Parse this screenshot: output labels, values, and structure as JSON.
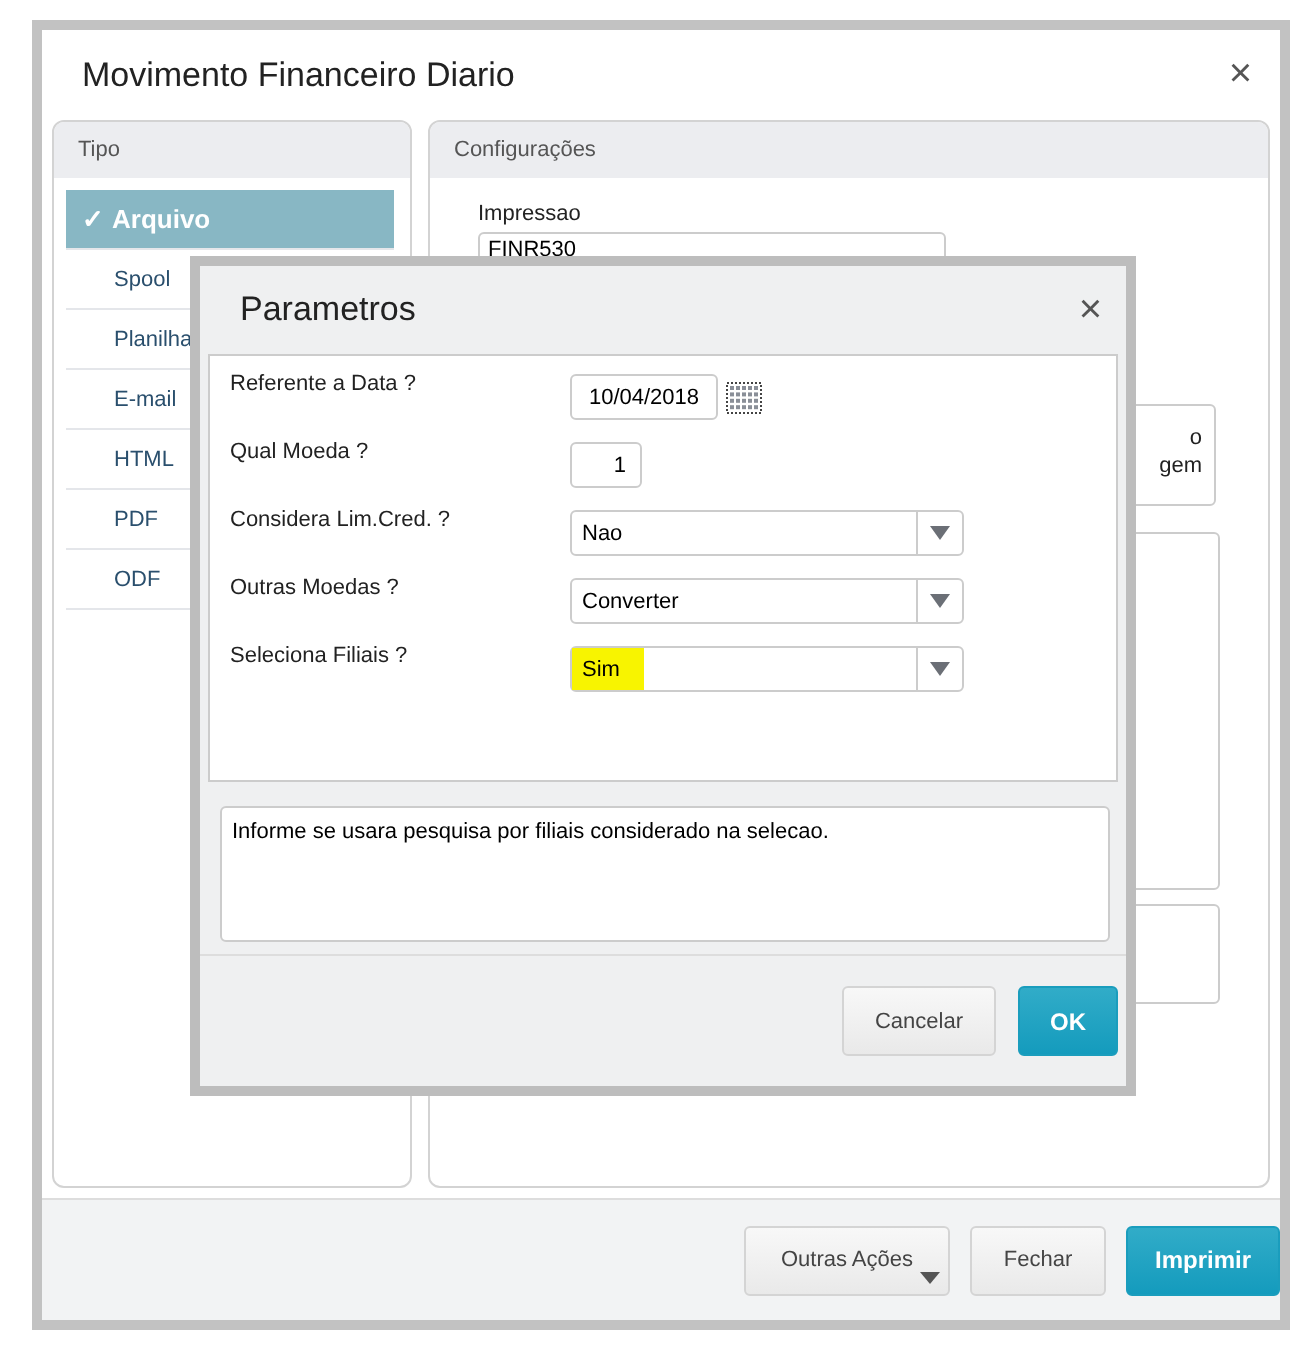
{
  "window": {
    "title": "Movimento Financeiro Diario",
    "close": "×"
  },
  "sidebar": {
    "title": "Tipo",
    "items": [
      {
        "label": "Arquivo",
        "selected": true,
        "check": "✓"
      },
      {
        "label": "Spool",
        "selected": false
      },
      {
        "label": "Planilha",
        "selected": false
      },
      {
        "label": "E-mail",
        "selected": false
      },
      {
        "label": "HTML",
        "selected": false
      },
      {
        "label": "PDF",
        "selected": false
      },
      {
        "label": "ODF",
        "selected": false
      }
    ]
  },
  "config": {
    "title": "Configurações",
    "field_label": "Impressao",
    "field_value": "FINR530",
    "option_lines": [
      "o",
      "gem"
    ]
  },
  "footer": {
    "buttons": [
      {
        "label": "Outras Ações",
        "kind": "menu"
      },
      {
        "label": "Fechar",
        "kind": "default"
      },
      {
        "label": "Imprimir",
        "kind": "primary"
      }
    ]
  },
  "dialog": {
    "title": "Parametros",
    "close": "×",
    "params": [
      {
        "label": "Referente a Data ?",
        "kind": "date",
        "value": "10/04/2018",
        "highlighted": false
      },
      {
        "label": "Qual Moeda ?",
        "kind": "number",
        "value": "1",
        "highlighted": false
      },
      {
        "label": "Considera Lim.Cred. ?",
        "kind": "select",
        "value": "Nao",
        "highlighted": false
      },
      {
        "label": "Outras Moedas ?",
        "kind": "select",
        "value": "Converter",
        "highlighted": false
      },
      {
        "label": "Seleciona Filiais ?",
        "kind": "select",
        "value": "Sim",
        "highlighted": true
      }
    ],
    "help": "Informe se usara pesquisa por filiais considerado na selecao.",
    "buttons": [
      {
        "label": "Cancelar",
        "kind": "default"
      },
      {
        "label": "OK",
        "kind": "primary"
      }
    ]
  }
}
